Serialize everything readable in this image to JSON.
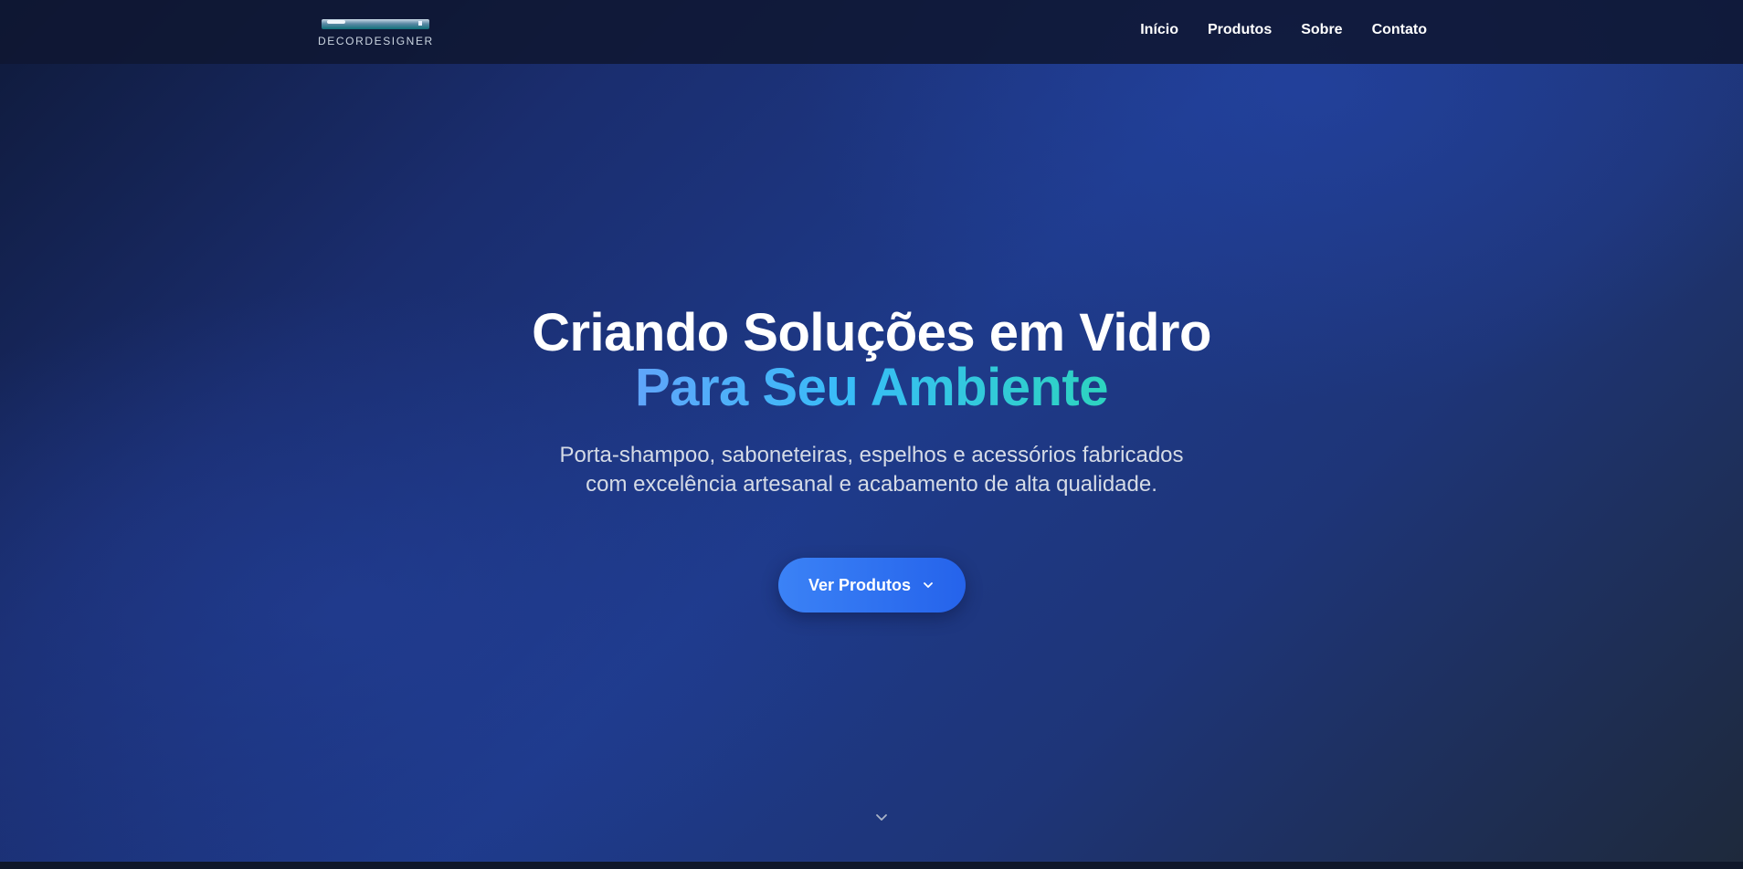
{
  "brand": {
    "name": "DECORDESIGNER"
  },
  "nav": {
    "items": [
      {
        "label": "Início"
      },
      {
        "label": "Produtos"
      },
      {
        "label": "Sobre"
      },
      {
        "label": "Contato"
      }
    ]
  },
  "hero": {
    "title_line1": "Criando Soluções em Vidro",
    "title_line2": "Para Seu Ambiente",
    "subtitle_line1": "Porta-shampoo, saboneteiras, espelhos e acessórios fabricados",
    "subtitle_line2": "com excelência artesanal e acabamento de alta qualidade.",
    "cta_label": "Ver Produtos",
    "cta_icon": "chevron-down-icon",
    "scroll_icon": "chevron-down-icon"
  },
  "colors": {
    "background_dark": "#0f172a",
    "background_blue": "#1e3a8a",
    "accent_blue": "#3b82f6",
    "gradient_start": "#60a5fa",
    "gradient_end": "#2dd4bf",
    "text_white": "#ffffff",
    "text_muted": "#d5dbe6"
  }
}
